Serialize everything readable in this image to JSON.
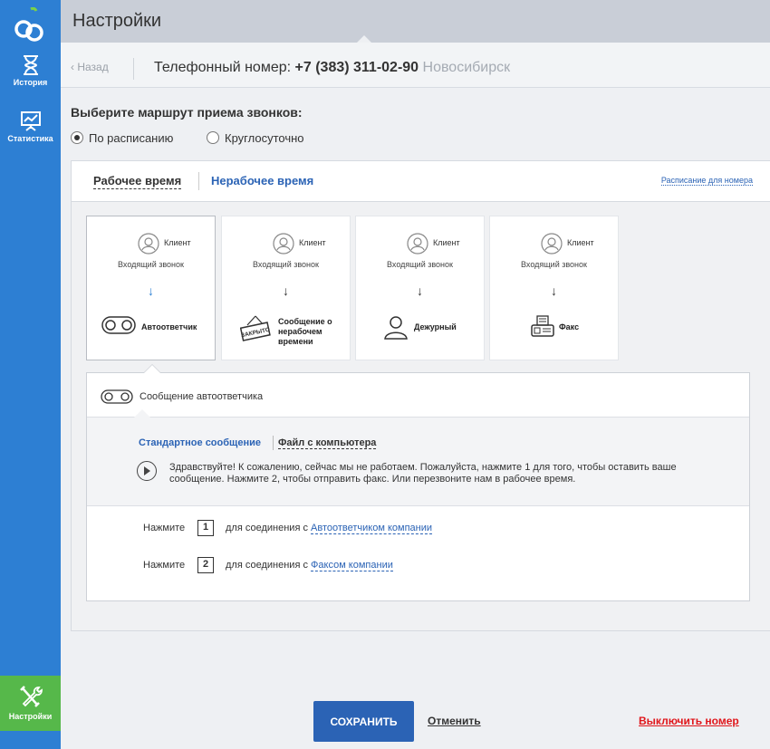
{
  "sidebar": {
    "items": [
      {
        "label": "История",
        "icon": "hourglass-icon"
      },
      {
        "label": "Статистика",
        "icon": "chart-board-icon"
      },
      {
        "label": "Настройки",
        "icon": "tools-icon"
      }
    ]
  },
  "header": {
    "title": "Настройки"
  },
  "subheader": {
    "back_label": "Назад",
    "phone_label": "Телефонный номер:",
    "phone_number": "+7 (383) 311-02-90",
    "city": "Новосибирск"
  },
  "route": {
    "label": "Выберите маршрут приема звонков:",
    "options": [
      {
        "label": "По расписанию",
        "checked": true
      },
      {
        "label": "Круглосуточно",
        "checked": false
      }
    ]
  },
  "tabs": {
    "work_time": "Рабочее время",
    "non_work_time": "Нерабочее время",
    "schedule_link": "Расписание для номера"
  },
  "cards": [
    {
      "client": "Клиент",
      "incoming": "Входящий звонок",
      "arrow": "↓",
      "destination": "Автоответчик",
      "selected": true
    },
    {
      "client": "Клиент",
      "incoming": "Входящий звонок",
      "arrow": "↓",
      "destination": "Сообщение о нерабочем времени",
      "sign_text": "ЗАКРЫТО",
      "selected": false
    },
    {
      "client": "Клиент",
      "incoming": "Входящий звонок",
      "arrow": "↓",
      "destination": "Дежурный",
      "selected": false
    },
    {
      "client": "Клиент",
      "incoming": "Входящий звонок",
      "arrow": "↓",
      "destination": "Факс",
      "selected": false
    }
  ],
  "answering": {
    "header": "Сообщение автоответчика",
    "tab_standard": "Стандартное сообщение",
    "tab_file": "Файл с компьютера",
    "message": "Здравствуйте! К сожалению, сейчас мы не работаем. Пожалуйста, нажмите 1 для того, чтобы оставить ваше сообщение. Нажмите 2, чтобы отправить факс. Или перезвоните нам в рабочее время.",
    "keys": [
      {
        "press": "Нажмите",
        "key": "1",
        "connect": "для соединения с",
        "target": "Автоответчиком компании"
      },
      {
        "press": "Нажмите",
        "key": "2",
        "connect": "для соединения с",
        "target": "Факсом компании"
      }
    ]
  },
  "footer": {
    "save": "СОХРАНИТЬ",
    "cancel": "Отменить",
    "disable": "Выключить номер"
  },
  "colors": {
    "sidebar": "#2d7fd3",
    "active_nav": "#56b84a",
    "accent": "#2b63b5",
    "danger": "#e0161b"
  }
}
